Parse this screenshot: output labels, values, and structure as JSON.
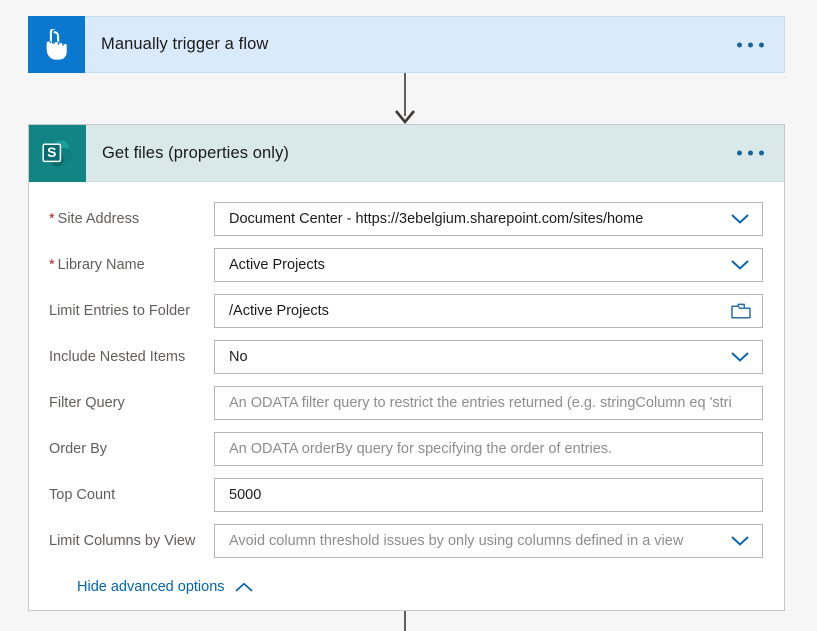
{
  "trigger_card": {
    "title": "Manually trigger a flow",
    "icon": "hand-tap-icon",
    "icon_bg": "#0b78d0",
    "header_bg": "#dbeafa",
    "menu": "more-options"
  },
  "action_card": {
    "title": "Get files (properties only)",
    "icon": "sharepoint-icon",
    "icon_bg": "#128484",
    "header_bg": "#d9e8e8",
    "menu": "more-options",
    "fields": [
      {
        "label": "Site Address",
        "required": true,
        "value": "Document Center - https://3ebelgium.sharepoint.com/sites/home",
        "is_placeholder": false,
        "control": "dropdown"
      },
      {
        "label": "Library Name",
        "required": true,
        "value": "Active Projects",
        "is_placeholder": false,
        "control": "dropdown"
      },
      {
        "label": "Limit Entries to Folder",
        "required": false,
        "value": "/Active Projects",
        "is_placeholder": false,
        "control": "folder-picker"
      },
      {
        "label": "Include Nested Items",
        "required": false,
        "value": "No",
        "is_placeholder": false,
        "control": "dropdown"
      },
      {
        "label": "Filter Query",
        "required": false,
        "value": "An ODATA filter query to restrict the entries returned (e.g. stringColumn eq 'stri",
        "is_placeholder": true,
        "control": "text"
      },
      {
        "label": "Order By",
        "required": false,
        "value": "An ODATA orderBy query for specifying the order of entries.",
        "is_placeholder": true,
        "control": "text"
      },
      {
        "label": "Top Count",
        "required": false,
        "value": "5000",
        "is_placeholder": false,
        "control": "text"
      },
      {
        "label": "Limit Columns by View",
        "required": false,
        "value": "Avoid column threshold issues by only using columns defined in a view",
        "is_placeholder": true,
        "control": "dropdown"
      }
    ],
    "advanced_toggle": {
      "label": "Hide advanced options",
      "icon": "chevron-up-icon"
    }
  },
  "colors": {
    "accent_blue": "#0263b0",
    "required_red": "#a4262c",
    "trigger_blue": "#0b78d0",
    "sharepoint_teal": "#128484"
  }
}
